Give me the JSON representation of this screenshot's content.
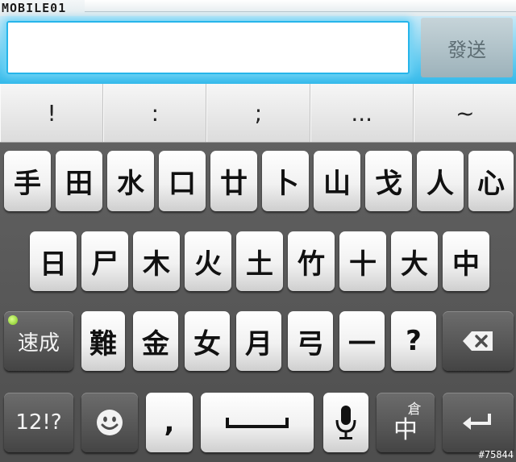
{
  "watermark": "MOBILE01",
  "composer": {
    "input_value": "",
    "send_label": "發送"
  },
  "punctuation": [
    "!",
    ":",
    ";",
    "...",
    "~"
  ],
  "keyboard": {
    "row1": [
      "手",
      "田",
      "水",
      "口",
      "廿",
      "卜",
      "山",
      "戈",
      "人",
      "心"
    ],
    "row2": [
      "日",
      "尸",
      "木",
      "火",
      "土",
      "竹",
      "十",
      "大",
      "中"
    ],
    "row3": [
      "難",
      "金",
      "女",
      "月",
      "弓",
      "一",
      "?"
    ],
    "quick_label": "速成",
    "symbols_label": "12!?",
    "comma_label": ",",
    "ime_top": "倉",
    "ime_bottom": "中"
  },
  "image_id": "#75844",
  "colors": {
    "accent": "#27b5ea",
    "keyboard_bg": "#555555"
  }
}
